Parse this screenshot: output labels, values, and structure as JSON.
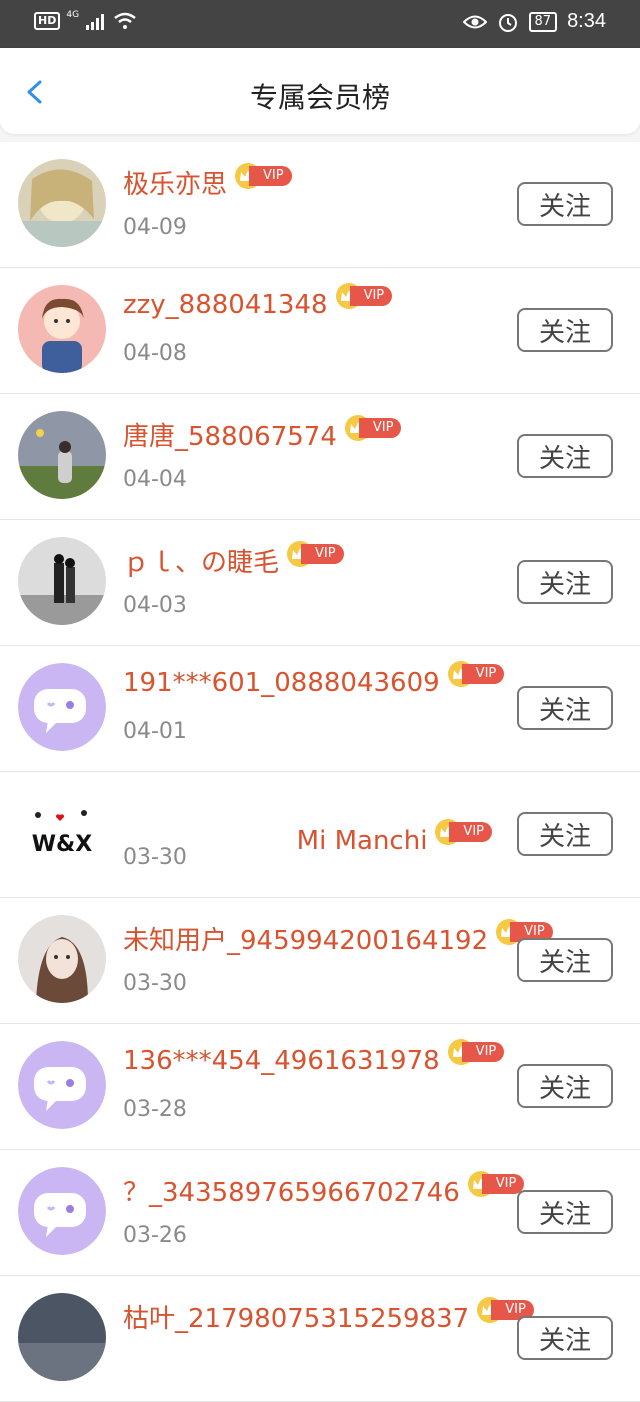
{
  "status_bar": {
    "hd": "HD",
    "network": "4G",
    "battery": "87",
    "time": "8:34"
  },
  "header": {
    "title": "专属会员榜"
  },
  "vip_label": "VIP",
  "follow_label": "关注",
  "members": [
    {
      "name": "极乐亦思",
      "date": "04-09",
      "avatar": "photo-girl-blond"
    },
    {
      "name": "zzy_888041348",
      "date": "04-08",
      "avatar": "cartoon-girl"
    },
    {
      "name": "唐唐_588067574",
      "date": "04-04",
      "avatar": "photo-field"
    },
    {
      "name": "ｐｌ、の睫毛",
      "date": "04-03",
      "avatar": "photo-couple"
    },
    {
      "name": "191***601_0888043609",
      "date": "04-01",
      "avatar": "default-chat-avatar"
    },
    {
      "name": "Mi Manchi",
      "date": "03-30",
      "avatar": "wx-text-avatar",
      "avatar_text": "W&X"
    },
    {
      "name": "未知用户_945994200164192",
      "date": "03-30",
      "avatar": "photo-girl"
    },
    {
      "name": "136***454_4961631978",
      "date": "03-28",
      "avatar": "default-chat-avatar"
    },
    {
      "name": "？_343589765966702746",
      "date": "03-26",
      "avatar": "default-chat-avatar"
    },
    {
      "name": "枯叶_21798075315259837",
      "date": "",
      "avatar": "photo-dark"
    }
  ],
  "colors": {
    "accent_blue": "#2f8ff0",
    "name_red": "#d9532f",
    "vip_red": "#e6574a",
    "crown_gold": "#f6c945",
    "default_avatar_purple": "#c9b6f2"
  }
}
